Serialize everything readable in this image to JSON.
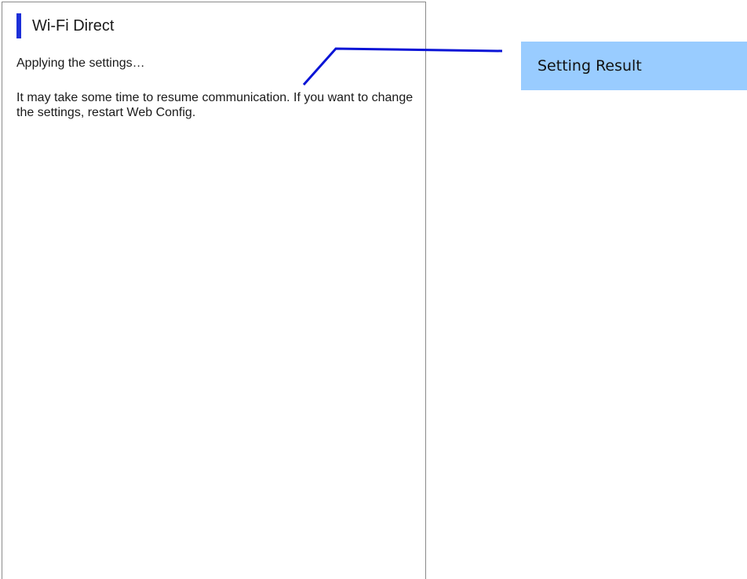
{
  "page": {
    "title": "Wi-Fi Direct",
    "status_message": "Applying the settings…",
    "info_message": "It may take some time to resume communication. If you want to change the settings, restart Web Config."
  },
  "callout": {
    "label": "Setting Result"
  },
  "colors": {
    "accent": "#1c2fd8",
    "callout_background": "#99ccff",
    "callout_line": "#0a14d6"
  }
}
